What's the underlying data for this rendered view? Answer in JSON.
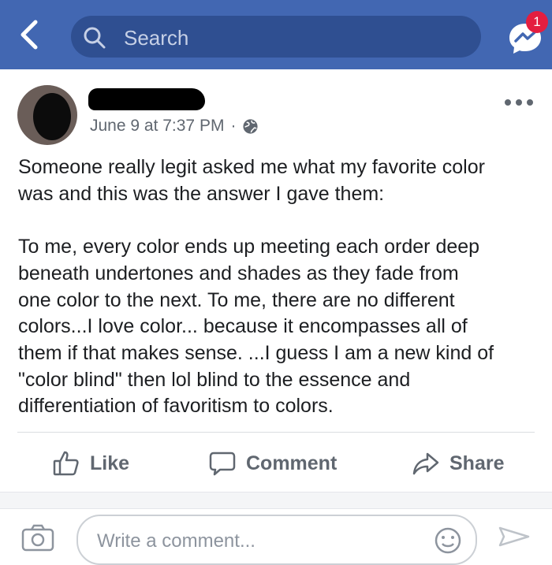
{
  "colors": {
    "topbar": "#4267b2",
    "search_bg": "#2f4f91",
    "badge": "#e41e3f",
    "muted_text": "#606770"
  },
  "header": {
    "search_placeholder": "Search",
    "messenger_badge": "1",
    "icons": [
      "back-arrow-icon",
      "search-icon",
      "messenger-icon"
    ]
  },
  "post": {
    "timestamp": "June 9 at 7:37 PM",
    "separator": "·",
    "privacy_icon": "globe-icon",
    "paragraphs": [
      "Someone really legit asked me what my favorite color\nwas and this was the answer I gave them:",
      "To me, every color ends up meeting each order deep\nbeneath undertones and shades as they fade from\none color to the next. To me, there are no different\ncolors...I love color... because it encompasses all of\nthem if that makes sense. ...I guess I am a new kind of\n\"color blind\" then lol blind to the essence and\ndifferentiation of favoritism to colors."
    ]
  },
  "actions": {
    "like": "Like",
    "comment": "Comment",
    "share": "Share"
  },
  "composer": {
    "placeholder": "Write a comment..."
  }
}
